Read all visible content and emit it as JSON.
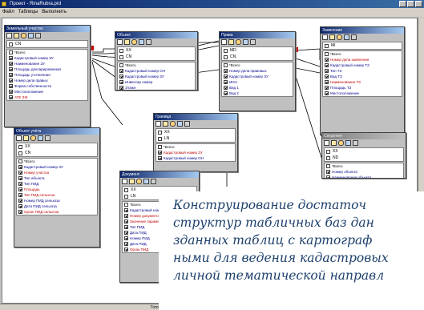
{
  "window": {
    "title": "Проект - RinaRubra.prd"
  },
  "menu": [
    "Файл",
    "Таблицы",
    "Выполнить"
  ],
  "tables": {
    "t1": {
      "title": "Земельный участок",
      "flags": [
        {
          "label": "CN",
          "on": false
        }
      ],
      "fields": [
        {
          "label": "*Всего",
          "color": "all",
          "checked": false
        },
        {
          "label": "Кадастровый номер ЗУ",
          "color": "normal",
          "checked": true
        },
        {
          "label": "Наименование ЗУ",
          "color": "normal",
          "checked": true
        },
        {
          "label": "Площадь декларированная",
          "color": "normal",
          "checked": true
        },
        {
          "label": "Площадь уточненная",
          "color": "normal",
          "checked": true
        },
        {
          "label": "Номер дела правых",
          "color": "normal",
          "checked": true
        },
        {
          "label": "Форма собственности",
          "color": "normal",
          "checked": true
        },
        {
          "label": "Местоположение",
          "color": "normal",
          "checked": true
        },
        {
          "label": "ATE ЗЖ",
          "color": "red",
          "checked": true
        }
      ]
    },
    "t2": {
      "title": "Объект",
      "flags": [
        {
          "label": "XX",
          "on": false
        },
        {
          "label": "CN",
          "on": false
        }
      ],
      "fields": [
        {
          "label": "*Всего",
          "color": "all",
          "checked": false
        },
        {
          "label": "Кадастровый номер ОН",
          "color": "normal",
          "checked": true
        },
        {
          "label": "Кадастровый номер ЗУ",
          "color": "normal",
          "checked": true
        },
        {
          "label": "Инвентар номер",
          "color": "normal",
          "checked": true
        },
        {
          "label": "Этажн",
          "color": "normal",
          "checked": true
        }
      ]
    },
    "t3": {
      "title": "Права",
      "flags": [
        {
          "label": "MD",
          "on": false
        },
        {
          "label": "CN",
          "on": false
        }
      ],
      "fields": [
        {
          "label": "*Всего",
          "color": "all",
          "checked": false
        },
        {
          "label": "Номер дела правовых",
          "color": "normal",
          "checked": true
        },
        {
          "label": "Кадастровый номер ЗУ",
          "color": "normal",
          "checked": true
        },
        {
          "label": "ИНН",
          "color": "normal",
          "checked": true
        },
        {
          "label": "Вид 1",
          "color": "normal",
          "checked": true
        },
        {
          "label": "Вид 2",
          "color": "normal",
          "checked": true
        }
      ]
    },
    "t4": {
      "title": "Заявление",
      "flags": [
        {
          "label": "MI",
          "on": false
        }
      ],
      "fields": [
        {
          "label": "*Всего",
          "color": "all",
          "checked": false
        },
        {
          "label": "Номер дела заявления",
          "color": "red",
          "checked": true
        },
        {
          "label": "Кадастровый номер ТЗ",
          "color": "normal",
          "checked": true
        },
        {
          "label": "Тип ТЗ",
          "color": "normal",
          "checked": true
        },
        {
          "label": "Вид ТЗ",
          "color": "normal",
          "checked": true
        },
        {
          "label": "Наименование ТЗ",
          "color": "red",
          "checked": true
        },
        {
          "label": "Площадь ТЗ",
          "color": "normal",
          "checked": true
        },
        {
          "label": "Местоположение",
          "color": "normal",
          "checked": true
        }
      ]
    },
    "t5": {
      "title": "Объект учёта",
      "flags": [
        {
          "label": "XX",
          "on": false
        },
        {
          "label": "CN",
          "on": false
        }
      ],
      "fields": [
        {
          "label": "*Всего",
          "color": "all",
          "checked": false
        },
        {
          "label": "Кадастровый номер ЗУ",
          "color": "normal",
          "checked": true
        },
        {
          "label": "Номер участка",
          "color": "red",
          "checked": true
        },
        {
          "label": "Тип объекта",
          "color": "normal",
          "checked": true
        },
        {
          "label": "Тип ПИД",
          "color": "normal",
          "checked": true
        },
        {
          "label": "Площадь",
          "color": "red",
          "checked": true
        },
        {
          "label": "Тип ПИД сельхоза",
          "color": "red",
          "checked": true
        },
        {
          "label": "Номер ПИД сельхоза",
          "color": "normal",
          "checked": true
        },
        {
          "label": "Дата ПИД сельхоза",
          "color": "normal",
          "checked": true
        },
        {
          "label": "Орган ПИД сельхоза",
          "color": "red",
          "checked": true
        }
      ]
    },
    "t6": {
      "title": "Граница",
      "flags": [
        {
          "label": "XX",
          "on": false
        },
        {
          "label": "LN",
          "on": false
        }
      ],
      "fields": [
        {
          "label": "*Всего",
          "color": "all",
          "checked": false
        },
        {
          "label": "Кадастровый номер ЗУ",
          "color": "red",
          "checked": true
        },
        {
          "label": "Кадастровый номер ОН",
          "color": "normal",
          "checked": true
        }
      ]
    },
    "t7": {
      "title": "Документ",
      "flags": [
        {
          "label": "XX",
          "on": false
        },
        {
          "label": "LN",
          "on": false
        }
      ],
      "fields": [
        {
          "label": "*Всего",
          "color": "all",
          "checked": false
        },
        {
          "label": "Кадастровый номер",
          "color": "normal",
          "checked": true
        },
        {
          "label": "Номер документа",
          "color": "red",
          "checked": true
        },
        {
          "label": "Значение параметра",
          "color": "red",
          "checked": true
        },
        {
          "label": "Тип ПИД",
          "color": "normal",
          "checked": true
        },
        {
          "label": "Дата ПИД",
          "color": "normal",
          "checked": true
        },
        {
          "label": "Номер ПИД",
          "color": "normal",
          "checked": true
        },
        {
          "label": "Дата ПИД",
          "color": "normal",
          "checked": true
        },
        {
          "label": "Орган ПИД",
          "color": "red",
          "checked": true
        }
      ]
    },
    "t8": {
      "title": "Сведения",
      "flags": [
        {
          "label": "XX",
          "on": false
        },
        {
          "label": "ND",
          "on": false
        }
      ],
      "fields": [
        {
          "label": "*Всего",
          "color": "all",
          "checked": false
        },
        {
          "label": "Номер объекта",
          "color": "normal",
          "checked": true
        },
        {
          "label": "Наименование объекта",
          "color": "normal",
          "checked": true
        }
      ]
    }
  },
  "caption": {
    "lines": [
      "Конструирование   достаточ",
      "структур табличных баз дан",
      "зданных таблиц с картограф",
      "ными для ведения кадастровых",
      "личной тематической направл"
    ]
  },
  "status": {
    "text": "Гото"
  }
}
